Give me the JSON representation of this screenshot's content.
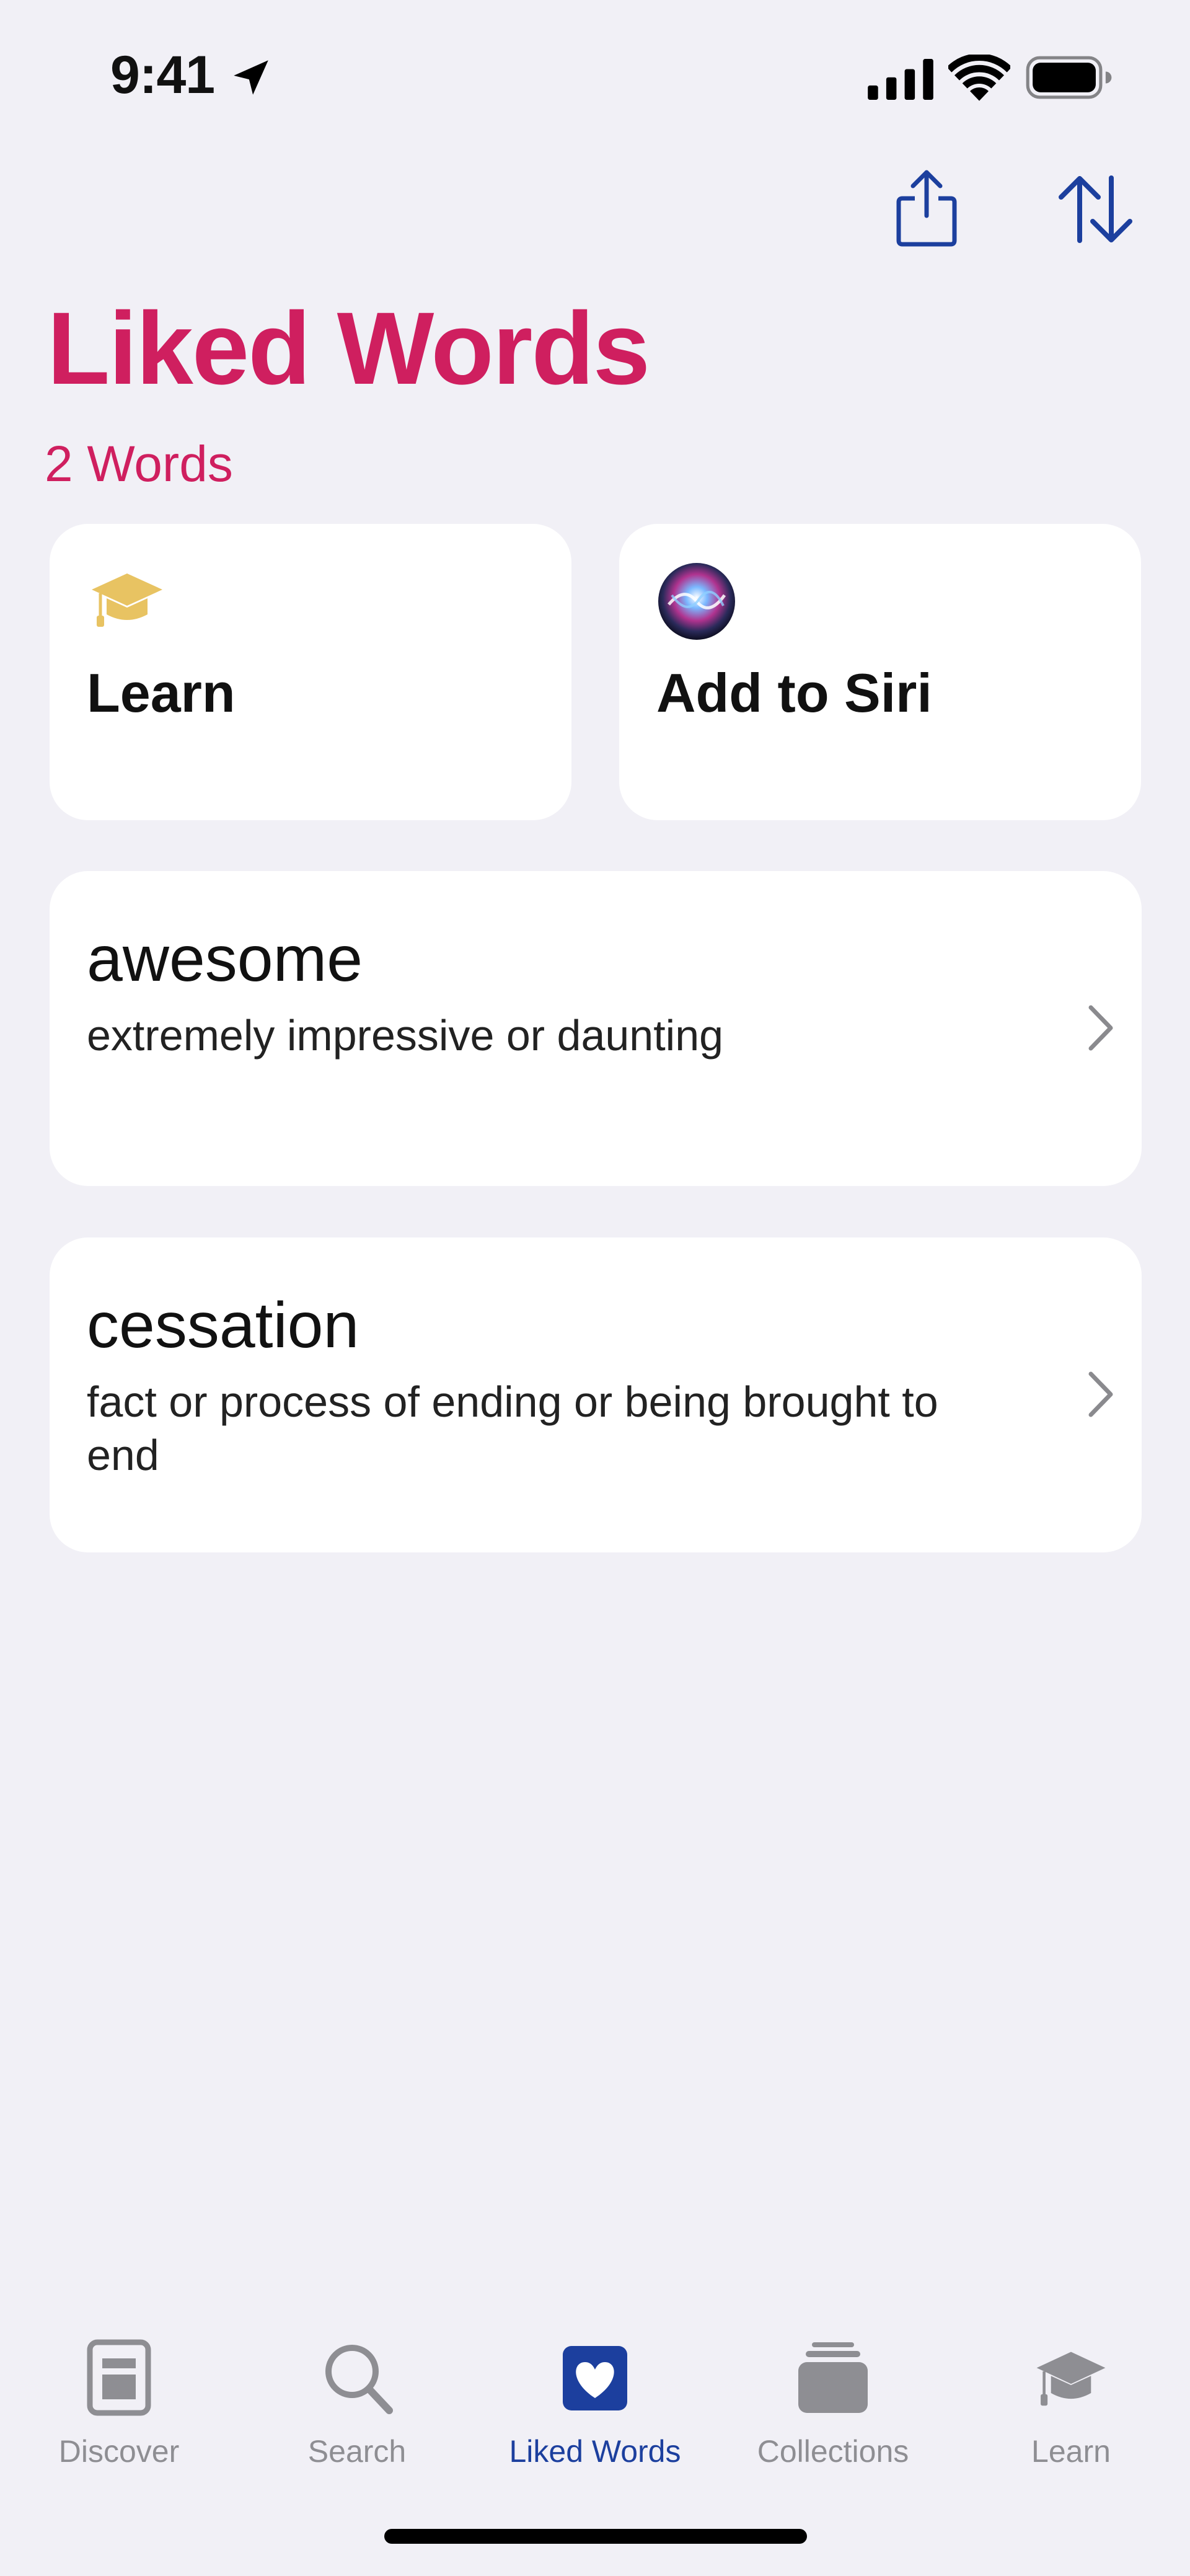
{
  "status": {
    "time": "9:41"
  },
  "header": {
    "title": "Liked Words",
    "count": "2 Words"
  },
  "actions": [
    {
      "label": "Learn",
      "icon": "graduation-cap-icon"
    },
    {
      "label": "Add to Siri",
      "icon": "siri-icon"
    }
  ],
  "words": [
    {
      "word": "awesome",
      "definition": "extremely impressive or daunting"
    },
    {
      "word": "cessation",
      "definition": "fact or process of ending or being brought to end"
    }
  ],
  "tabs": [
    {
      "label": "Discover",
      "icon": "newspaper-icon"
    },
    {
      "label": "Search",
      "icon": "magnifier-icon"
    },
    {
      "label": "Liked Words",
      "icon": "heart-square-icon",
      "active": true
    },
    {
      "label": "Collections",
      "icon": "stack-icon"
    },
    {
      "label": "Learn",
      "icon": "graduation-cap-icon"
    }
  ],
  "colors": {
    "accent": "#cf1f5f",
    "tint": "#1c3f9e",
    "inactive": "#8e8e93",
    "background": "#f1f0f6"
  }
}
